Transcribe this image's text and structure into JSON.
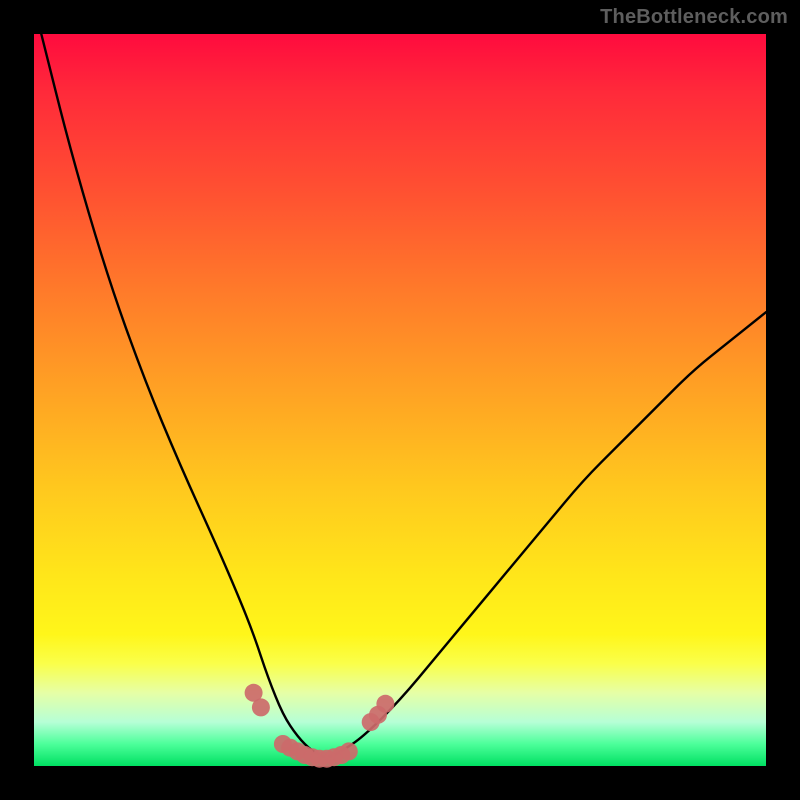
{
  "watermark": "TheBottleneck.com",
  "chart_data": {
    "type": "line",
    "title": "",
    "xlabel": "",
    "ylabel": "",
    "xlim": [
      0,
      100
    ],
    "ylim": [
      0,
      100
    ],
    "series": [
      {
        "name": "bottleneck-curve",
        "color": "#000000",
        "x": [
          1,
          5,
          10,
          15,
          20,
          25,
          28,
          30,
          32,
          34,
          36,
          38,
          40,
          42,
          45,
          50,
          55,
          60,
          65,
          70,
          75,
          80,
          85,
          90,
          95,
          100
        ],
        "values": [
          100,
          84,
          67,
          53,
          41,
          30,
          23,
          18,
          12,
          7,
          4,
          2,
          1,
          2,
          4,
          9,
          15,
          21,
          27,
          33,
          39,
          44,
          49,
          54,
          58,
          62
        ]
      },
      {
        "name": "bottleneck-markers",
        "color": "#cc6a6a",
        "x": [
          30,
          31,
          34,
          35,
          36,
          37,
          38,
          39,
          40,
          41,
          42,
          43,
          46,
          47,
          48
        ],
        "values": [
          10,
          8,
          3,
          2.5,
          2,
          1.5,
          1.2,
          1,
          1,
          1.2,
          1.5,
          2,
          6,
          7,
          8.5
        ]
      }
    ]
  },
  "colors": {
    "gradient_top": "#ff0b3e",
    "gradient_mid": "#ffe61a",
    "gradient_bottom": "#00e062",
    "curve": "#000000",
    "markers": "#cc6a6a"
  }
}
